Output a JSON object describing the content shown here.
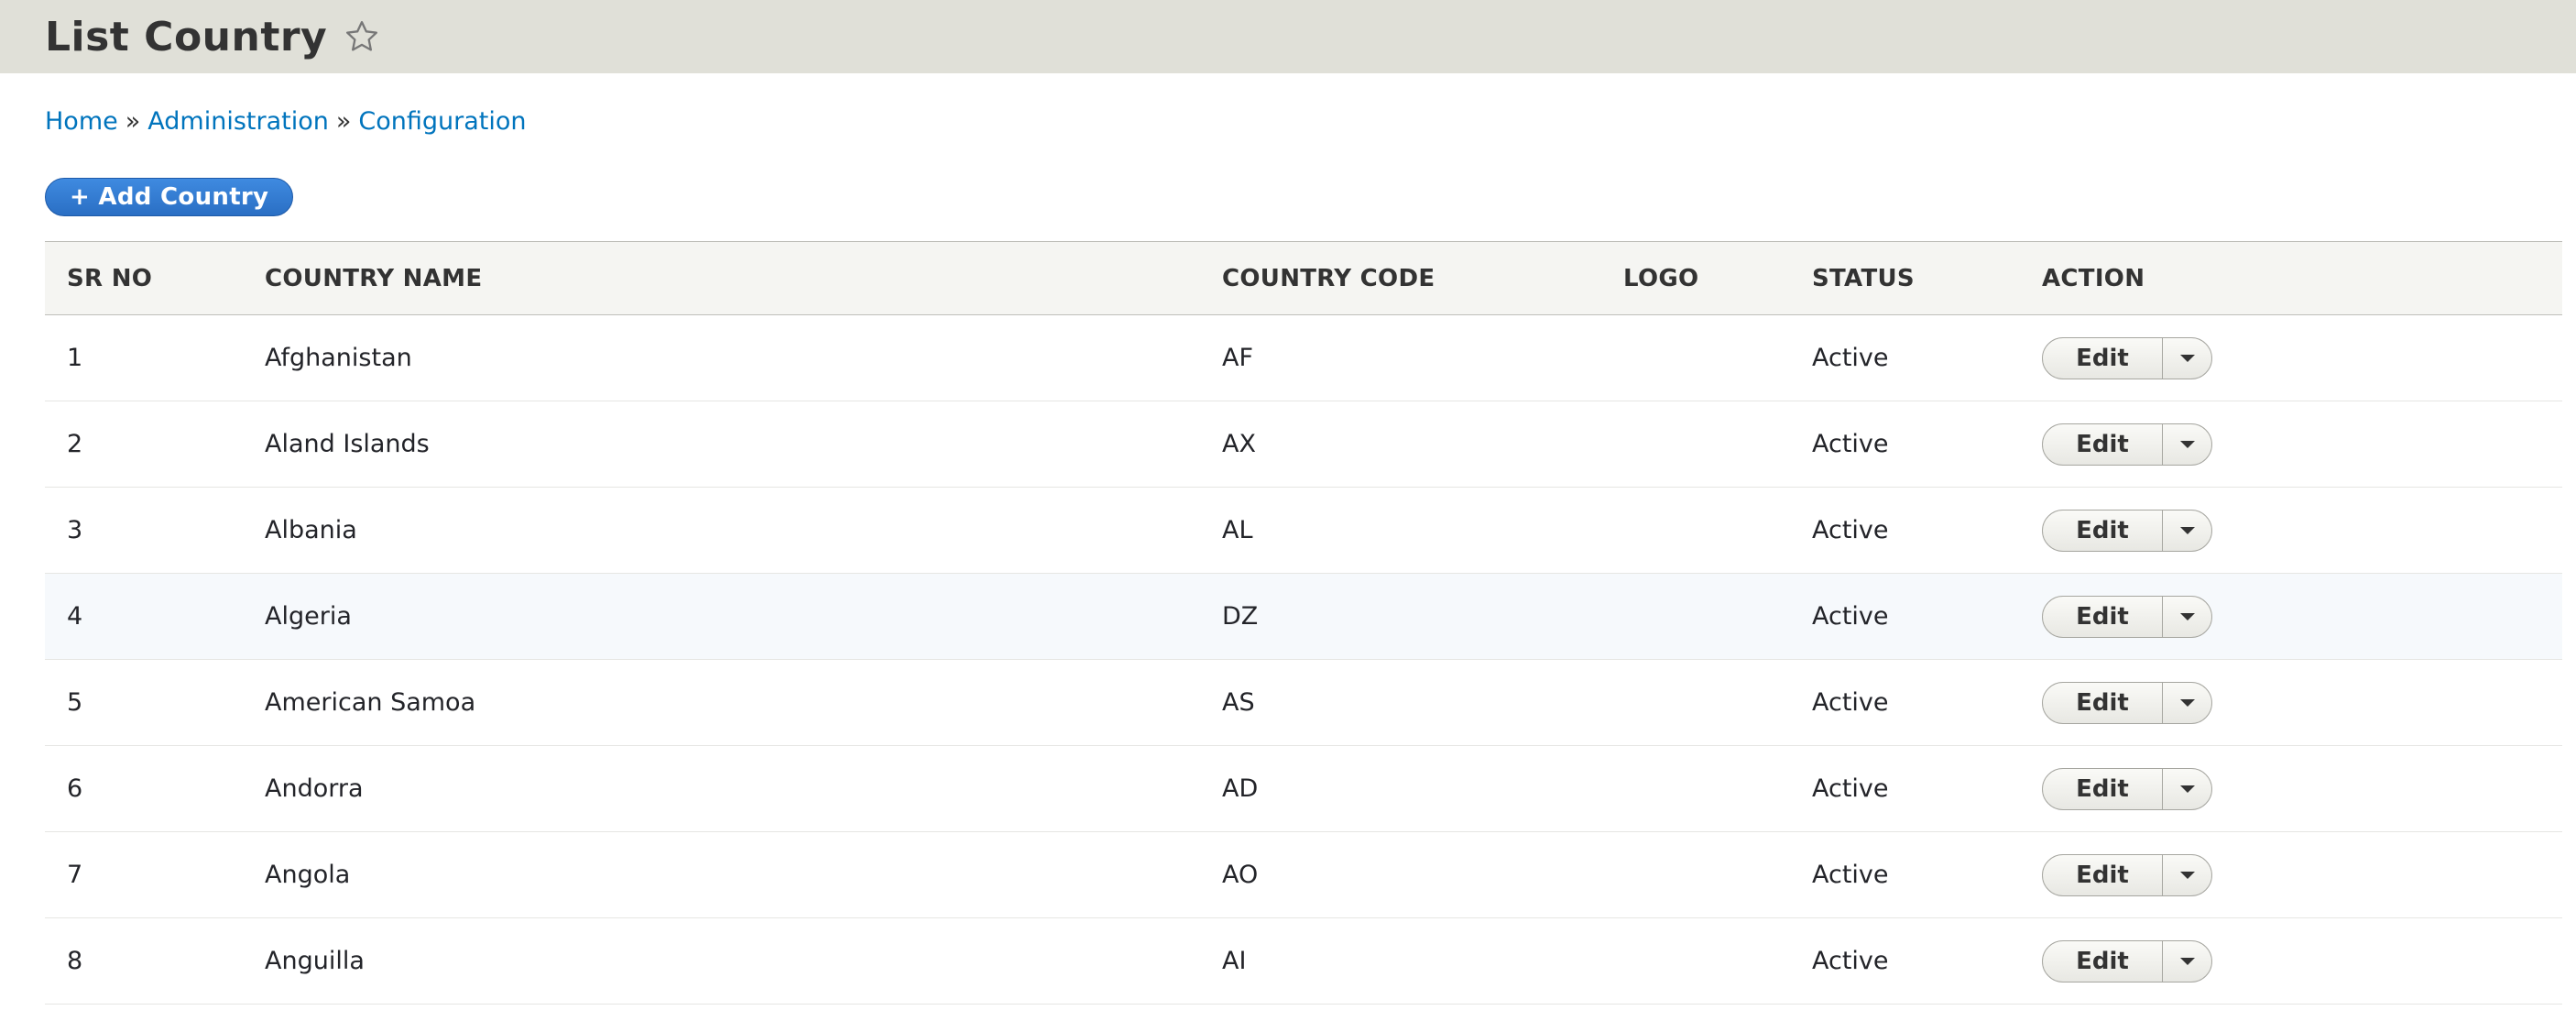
{
  "header": {
    "title": "List Country",
    "star_icon": "star-outline-icon"
  },
  "breadcrumb": {
    "items": [
      "Home",
      "Administration",
      "Configuration"
    ],
    "separator": "»"
  },
  "toolbar": {
    "add_label": "+ Add Country"
  },
  "table": {
    "columns": [
      "SR NO",
      "COUNTRY NAME",
      "COUNTRY CODE",
      "LOGO",
      "STATUS",
      "ACTION"
    ],
    "rows": [
      {
        "sr": "1",
        "name": "Afghanistan",
        "code": "AF",
        "logo": "",
        "status": "Active",
        "action": "Edit"
      },
      {
        "sr": "2",
        "name": "Aland Islands",
        "code": "AX",
        "logo": "",
        "status": "Active",
        "action": "Edit"
      },
      {
        "sr": "3",
        "name": "Albania",
        "code": "AL",
        "logo": "",
        "status": "Active",
        "action": "Edit"
      },
      {
        "sr": "4",
        "name": "Algeria",
        "code": "DZ",
        "logo": "",
        "status": "Active",
        "action": "Edit"
      },
      {
        "sr": "5",
        "name": "American Samoa",
        "code": "AS",
        "logo": "",
        "status": "Active",
        "action": "Edit"
      },
      {
        "sr": "6",
        "name": "Andorra",
        "code": "AD",
        "logo": "",
        "status": "Active",
        "action": "Edit"
      },
      {
        "sr": "7",
        "name": "Angola",
        "code": "AO",
        "logo": "",
        "status": "Active",
        "action": "Edit"
      },
      {
        "sr": "8",
        "name": "Anguilla",
        "code": "AI",
        "logo": "",
        "status": "Active",
        "action": "Edit"
      }
    ]
  },
  "colors": {
    "header_bg": "#e0e0d8",
    "link": "#0074bd",
    "primary_button": "#2f7bd2"
  }
}
